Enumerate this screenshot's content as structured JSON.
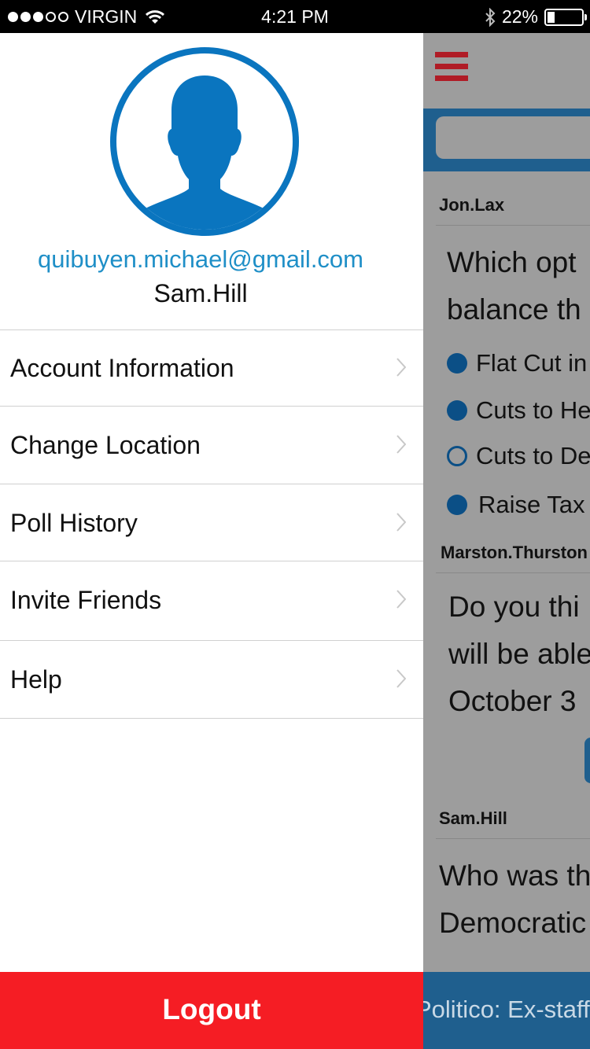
{
  "status_bar": {
    "carrier": "VIRGIN",
    "time": "4:21 PM",
    "battery": "22%",
    "battery_level": 0.22
  },
  "drawer": {
    "email": "quibuyen.michael@gmail.com",
    "username": "Sam.Hill",
    "menu": [
      {
        "label": "Account Information"
      },
      {
        "label": "Change Location"
      },
      {
        "label": "Poll History"
      },
      {
        "label": "Invite Friends"
      },
      {
        "label": "Help"
      }
    ],
    "logout_label": "Logout"
  },
  "feed": {
    "polls": [
      {
        "author": "Jon.Lax",
        "question_lines": [
          "Which opt",
          "balance th"
        ],
        "options": [
          "Flat Cut in",
          "Cuts to He",
          "Cuts to De",
          "Raise Tax"
        ]
      },
      {
        "author": "Marston.Thurston",
        "question_lines": [
          "Do you thi",
          "will be able",
          "October 3"
        ]
      },
      {
        "author": "Sam.Hill",
        "question_lines": [
          "Who was th",
          "Democratic"
        ]
      }
    ],
    "ticker": "Politico: Ex-staff"
  },
  "colors": {
    "accent_blue": "#0a75bf",
    "email_blue": "#1f8fc7",
    "logout_red": "#f51d24",
    "menu_red": "#b01c26",
    "navy": "#1f5f8e"
  },
  "icons": {
    "signal": "signal-dots-icon",
    "wifi": "wifi-icon",
    "bluetooth": "bluetooth-icon",
    "battery": "battery-icon",
    "avatar": "user-silhouette-icon",
    "chevron": "chevron-right-icon",
    "menu": "hamburger-menu-icon"
  }
}
